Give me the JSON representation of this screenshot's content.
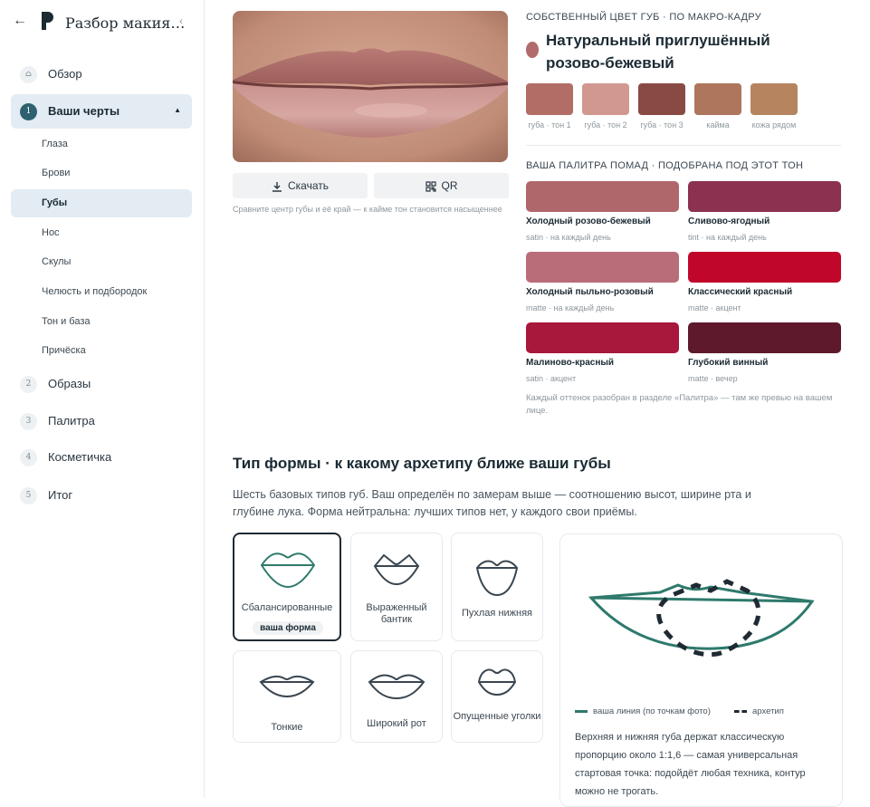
{
  "sidebar": {
    "brand": "Разбор макия…",
    "nav": [
      {
        "num": "",
        "label": "Обзор"
      },
      {
        "num": "1",
        "label": "Ваши черты"
      },
      {
        "num": "2",
        "label": "Образы"
      },
      {
        "num": "3",
        "label": "Палитра"
      },
      {
        "num": "4",
        "label": "Косметичка"
      },
      {
        "num": "5",
        "label": "Итог"
      }
    ],
    "sub": [
      "Глаза",
      "Брови",
      "Губы",
      "Нос",
      "Скулы",
      "Челюсть и подбородок",
      "Тон и база",
      "Причёска"
    ]
  },
  "photo": {
    "download": "Скачать",
    "qr": "QR",
    "caption": "Сравните центр губы и её край — к кайме тон становится насыщеннее"
  },
  "tone": {
    "overline": "СОБСТВЕННЫЙ ЦВЕТ ГУБ · ПО МАКРО-КАДРУ",
    "title": "Натуральный приглушённый розово-бежевый",
    "dot_color": "#b06b6a",
    "swatches": [
      {
        "label": "губа · тон 1",
        "color": "#b26e66"
      },
      {
        "label": "губа · тон 2",
        "color": "#d19890"
      },
      {
        "label": "губа · тон 3",
        "color": "#8a4a44"
      },
      {
        "label": "кайма",
        "color": "#ad765d"
      },
      {
        "label": "кожа рядом",
        "color": "#b6855f"
      }
    ]
  },
  "palette": {
    "overline": "ВАША ПАЛИТРА ПОМАД · ПОДОБРАНА ПОД ЭТОТ ТОН",
    "items": [
      {
        "name": "Холодный розово-бежевый",
        "sub": "satin · на каждый день",
        "color": "#b0676c"
      },
      {
        "name": "Сливово-ягодный",
        "sub": "tint · на каждый день",
        "color": "#8c3150"
      },
      {
        "name": "Холодный пыльно-розовый",
        "sub": "matte · на каждый день",
        "color": "#b86d78"
      },
      {
        "name": "Классический красный",
        "sub": "matte · акцент",
        "color": "#c0072a"
      },
      {
        "name": "Малиново-красный",
        "sub": "satin · акцент",
        "color": "#a8173c"
      },
      {
        "name": "Глубокий винный",
        "sub": "matte · вечер",
        "color": "#5e1a2c"
      }
    ],
    "note": "Каждый оттенок разобран в разделе «Палитра» — там же превью на вашем лице."
  },
  "shapes": {
    "title": "Тип формы · к какому архетипу ближе ваши губы",
    "desc": "Шесть базовых типов губ. Ваш определён по замерам выше — соотношению высот, ширине рта и глубине лука. Форма нейтральна: лучших типов нет, у каждого свои приёмы.",
    "cards": [
      {
        "label": "Сбалансированные",
        "badge": "ваша форма",
        "icon": "balanced-lips-icon"
      },
      {
        "label": "Выраженный бантик",
        "icon": "cupid-bow-lips-icon"
      },
      {
        "label": "Пухлая нижняя",
        "icon": "full-lower-lips-icon"
      },
      {
        "label": "Тонкие",
        "icon": "thin-lips-icon"
      },
      {
        "label": "Широкий рот",
        "icon": "wide-lips-icon"
      },
      {
        "label": "Опущенные уголки",
        "icon": "downturned-lips-icon"
      }
    ],
    "detail": {
      "legend_line": "ваша линия (по точкам фото)",
      "legend_archetype": "архетип",
      "line_color": "#2e7a6c",
      "text": "Верхняя и нижняя губа держат классическую пропорцию около 1:1,6 — самая универсальная стартовая точка: подойдёт любая техника, контур можно не трогать."
    }
  }
}
